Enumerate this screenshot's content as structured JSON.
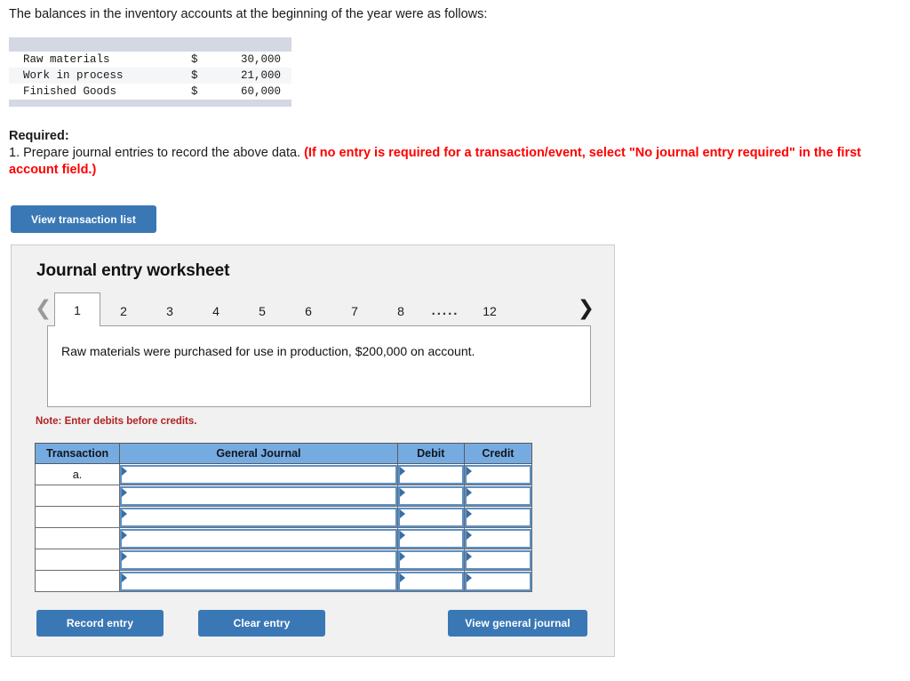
{
  "intro": {
    "text": "The balances in the inventory accounts at the beginning of the year were as follows:"
  },
  "balances_table": {
    "rows": [
      {
        "label": "Raw materials",
        "currency": "$",
        "amount": "30,000"
      },
      {
        "label": "Work in process",
        "currency": "$",
        "amount": "21,000"
      },
      {
        "label": "Finished Goods",
        "currency": "$",
        "amount": "60,000"
      }
    ]
  },
  "required": {
    "heading": "Required:",
    "line1": "1. Prepare journal entries to record the above data.",
    "red_note": "(If no entry is required for a transaction/event, select \"No journal entry required\" in the first account field.)"
  },
  "buttons": {
    "view_transaction_list": "View transaction list",
    "record_entry": "Record entry",
    "clear_entry": "Clear entry",
    "view_general_journal": "View general journal"
  },
  "worksheet": {
    "title": "Journal entry worksheet",
    "prev_icon": "chevron-left",
    "next_icon": "chevron-right",
    "tabs": [
      {
        "label": "1",
        "active": true
      },
      {
        "label": "2",
        "active": false
      },
      {
        "label": "3",
        "active": false
      },
      {
        "label": "4",
        "active": false
      },
      {
        "label": "5",
        "active": false
      },
      {
        "label": "6",
        "active": false
      },
      {
        "label": "7",
        "active": false
      },
      {
        "label": "8",
        "active": false
      },
      {
        "label": ".....",
        "active": false
      },
      {
        "label": "12",
        "active": false
      }
    ],
    "description": "Raw materials were purchased for use in production, $200,000 on account.",
    "note": "Note: Enter debits before credits.",
    "journal": {
      "headers": [
        "Transaction",
        "General Journal",
        "Debit",
        "Credit"
      ],
      "rows": [
        {
          "transaction": "a.",
          "general_journal": "",
          "debit": "",
          "credit": ""
        },
        {
          "transaction": "",
          "general_journal": "",
          "debit": "",
          "credit": ""
        },
        {
          "transaction": "",
          "general_journal": "",
          "debit": "",
          "credit": ""
        },
        {
          "transaction": "",
          "general_journal": "",
          "debit": "",
          "credit": ""
        },
        {
          "transaction": "",
          "general_journal": "",
          "debit": "",
          "credit": ""
        },
        {
          "transaction": "",
          "general_journal": "",
          "debit": "",
          "credit": ""
        }
      ]
    }
  },
  "colors": {
    "button_blue": "#3a78b5",
    "table_header_blue": "#76abe2",
    "band_gray": "#d4d8e3",
    "panel_gray": "#f1f1f1",
    "red_bold": "#ff0000",
    "note_red": "#b12222"
  }
}
